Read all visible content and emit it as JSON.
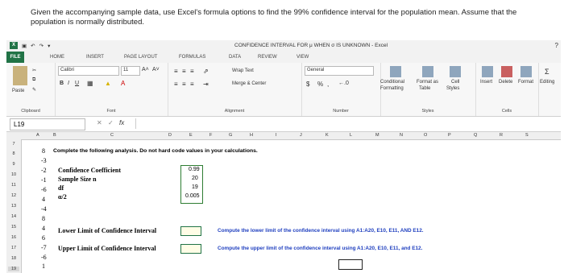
{
  "question": "Given the accompanying sample data, use Excel's formula options to find the 99% confidence interval for the population mean. Assume that the population is normally distributed.",
  "window": {
    "title": "CONFIDENCE INTERVAL FOR μ WHEN σ IS UNKNOWN - Excel",
    "help": "?"
  },
  "tabs": [
    "FILE",
    "HOME",
    "INSERT",
    "PAGE LAYOUT",
    "FORMULAS",
    "DATA",
    "REVIEW",
    "VIEW"
  ],
  "ribbon": {
    "paste": "Paste",
    "clipboard": "Clipboard",
    "font_name": "Calibri",
    "font_size": "11",
    "font_group": "Font",
    "bold": "B",
    "italic": "I",
    "underline": "U",
    "grow": "A˄",
    "shrink": "A˅",
    "wrap_text": "Wrap Text",
    "merge_center": "Merge & Center",
    "alignment": "Alignment",
    "number_format": "General",
    "currency": "$",
    "percent": "%",
    "comma": ",",
    "number_group": "Number",
    "conditional": "Conditional",
    "formatting": "Formatting",
    "format_as": "Format as",
    "table": "Table",
    "cell": "Cell",
    "cell_styles": "Styles",
    "styles_group": "Styles",
    "insert": "Insert",
    "delete": "Delete",
    "format": "Format",
    "cells_group": "Cells",
    "editing": "Editing"
  },
  "formula_bar": {
    "name_box": "L19",
    "cancel": "✕",
    "enter": "✓",
    "fx": "fx"
  },
  "columns": [
    "A",
    "B",
    "C",
    "D",
    "E",
    "F",
    "G",
    "H",
    "I",
    "J",
    "K",
    "L",
    "M",
    "N",
    "O",
    "P",
    "Q",
    "R",
    "S"
  ],
  "rows": [
    "7",
    "8",
    "9",
    "10",
    "11",
    "12",
    "13",
    "14",
    "15",
    "16",
    "17",
    "18",
    "19"
  ],
  "sheet": {
    "header": "Complete the following analysis. Do not hard code values in your calculations.",
    "data_values": [
      "8",
      "-3",
      "-2",
      "-1",
      "-6",
      "4",
      "-4",
      "8",
      "4",
      "6",
      "-7",
      "-6",
      "1"
    ],
    "labels": {
      "cc": "Confidence Coefficient",
      "n": "Sample Size n",
      "df": "df",
      "a2": "α/2"
    },
    "values": {
      "cc": "0.99",
      "n": "20",
      "df": "19",
      "a2": "0.005"
    },
    "lower_label": "Lower Limit of Confidence Interval",
    "upper_label": "Upper Limit of Confidence Interval",
    "lower_instr": "Compute the lower limit of the confidence interval using A1:A20, E10, E11, AND E12.",
    "upper_instr": "Compute the upper limit of the confidence interval using A1:A20, E10, E11, and E12."
  }
}
